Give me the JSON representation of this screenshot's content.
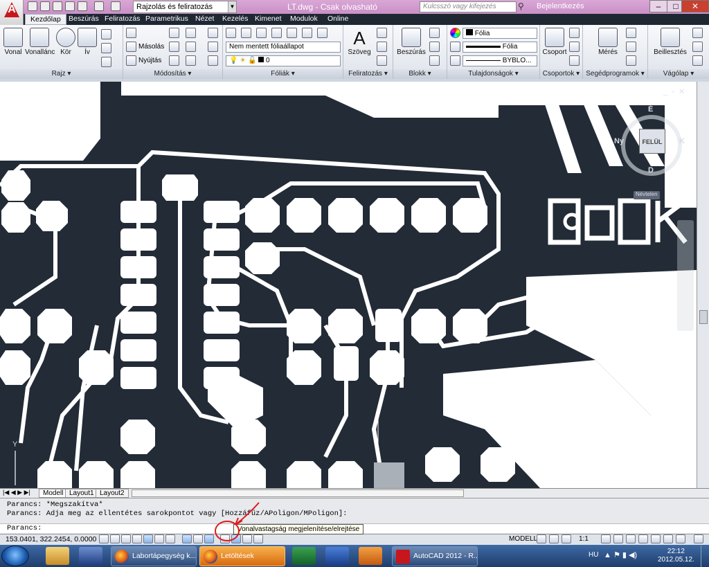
{
  "title_bar": {
    "workspace": "Rajzolás és feliratozás",
    "window_title": "LT.dwg - Csak olvasható",
    "search_placeholder": "Kulcsszó vagy kifejezés",
    "login": "Bejelentkezés"
  },
  "tabs": [
    "Kezdőlap",
    "Beszúrás",
    "Feliratozás",
    "Parametrikus",
    "Nézet",
    "Kezelés",
    "Kimenet",
    "Modulok",
    "Online"
  ],
  "ribbon": {
    "draw": {
      "label": "Rajz",
      "tools": [
        "Vonal",
        "Vonallánc",
        "Kör",
        "Ív"
      ]
    },
    "modify": {
      "label": "Módosítás",
      "tools": [
        "Másolás",
        "Nyújtás"
      ]
    },
    "layers": {
      "label": "Fóliák",
      "state": "Nem mentett fóliaállapot",
      "current": "0"
    },
    "annotation": {
      "label": "Feliratozás",
      "tool": "Szöveg"
    },
    "block": {
      "label": "Blokk",
      "tool": "Beszúrás"
    },
    "properties": {
      "label": "Tulajdonságok",
      "color": "Fólia",
      "linetype": "Fólia",
      "lineweight": "BYBLO..."
    },
    "groups": {
      "label": "Csoportok",
      "tool": "Csoport"
    },
    "utilities": {
      "label": "Segédprogramok",
      "tool": "Mérés"
    },
    "clipboard": {
      "label": "Vágólap",
      "tool": "Beillesztés"
    }
  },
  "viewcube": {
    "top": "FELÜL",
    "n": "É",
    "s": "D",
    "e": "K",
    "w": "Ny",
    "wcs": "Névtelen"
  },
  "layout_tabs": [
    "Modell",
    "Layout1",
    "Layout2"
  ],
  "command": {
    "line1": "Parancs: *Megszakítva*",
    "line2": "Parancs: Adja meg az ellentétes sarokpontot vagy [Hozzáfűz/APoligon/MPoligon]:",
    "prompt": "Parancs:"
  },
  "tooltip": "Vonalvastagság megjelenítése/elrejtése",
  "status": {
    "coords": "153.0401, 322.2454, 0.0000",
    "space": "MODELL",
    "scale": "1:1"
  },
  "taskbar": {
    "tasks": [
      "Labortápegység k...",
      "Letöltések",
      "AutoCAD 2012 - R..."
    ],
    "lang": "HU",
    "time": "22:12",
    "date": "2012.05.12."
  },
  "colors": {
    "accent": "#c8161d",
    "title_bar": "#c98fc6",
    "canvas": "#222b36",
    "active_task": "#e07c18"
  }
}
